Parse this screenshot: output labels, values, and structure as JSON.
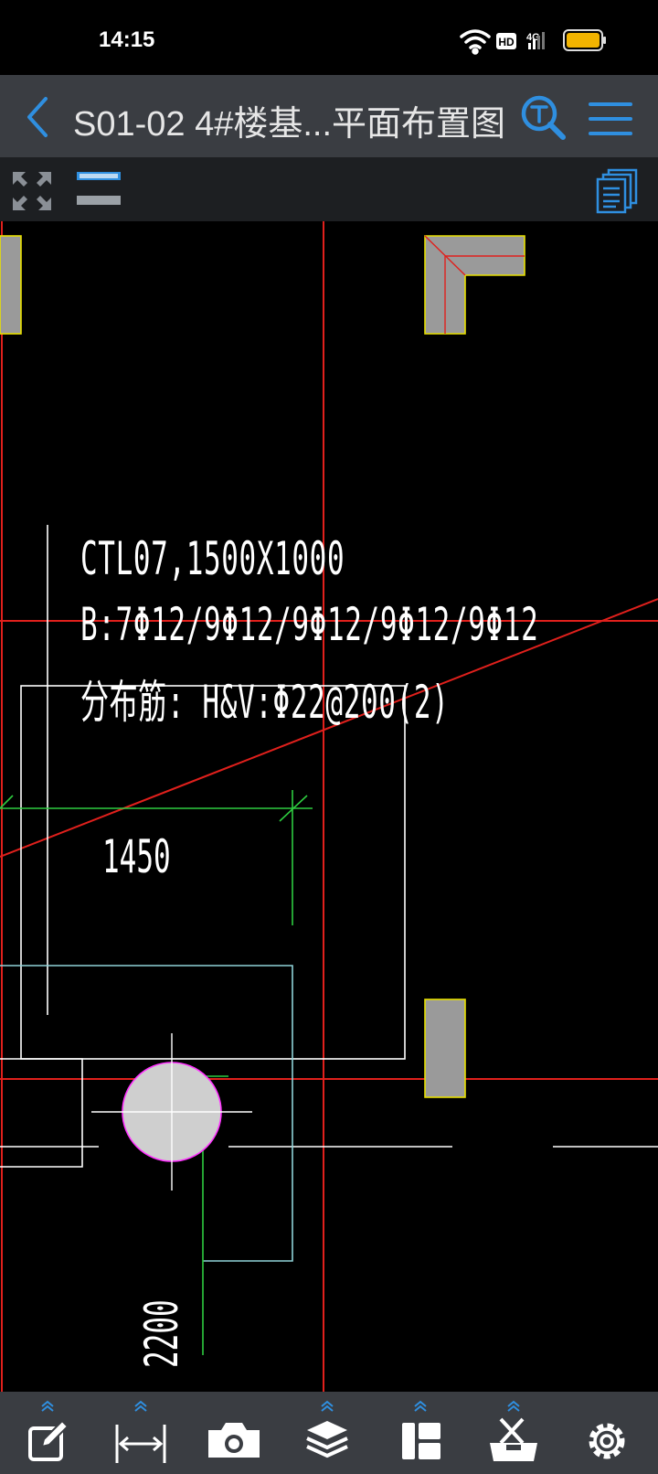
{
  "status_bar": {
    "time": "14:15",
    "icons": [
      "wifi-icon",
      "hd-icon",
      "signal-4g-icon",
      "battery-icon"
    ],
    "hd_text": "HD",
    "network_text": "4G"
  },
  "header": {
    "title": "S01-02 4#楼基...平面布置图",
    "back_icon": "back-chevron-icon",
    "search_icon": "text-search-icon",
    "menu_icon": "hamburger-menu-icon"
  },
  "toolstrip": {
    "icons": [
      "expand-fullscreen-icon",
      "layer-lines-icon",
      "pages-icon"
    ]
  },
  "drawing": {
    "annotations": {
      "beam_label": "CTL07,1500X1000",
      "bottom_rebar": "B:7Φ12/9Φ12/9Φ12/9Φ12/9Φ12",
      "distribution_rebar": "分布筋: H&V:Φ22@200(2)",
      "dimension_horizontal": "1450",
      "dimension_vertical": "2200"
    },
    "colors": {
      "background": "#000000",
      "axis_line": "#e0201c",
      "outline": "#ffffff",
      "dimension": "#2ecc40",
      "cyan_outline": "#8fd3d8",
      "column_fill": "#9a9a9a",
      "column_edge": "#e8e000",
      "pile": "#c8c8c8",
      "pile_edge": "#ff33ff"
    }
  },
  "bottom_toolbar": {
    "buttons": [
      "edit-note-icon",
      "measure-icon",
      "camera-icon",
      "layers-icon",
      "layout-icon",
      "toolbox-icon",
      "settings-gear-icon"
    ],
    "accent": "#2f8fe0"
  }
}
